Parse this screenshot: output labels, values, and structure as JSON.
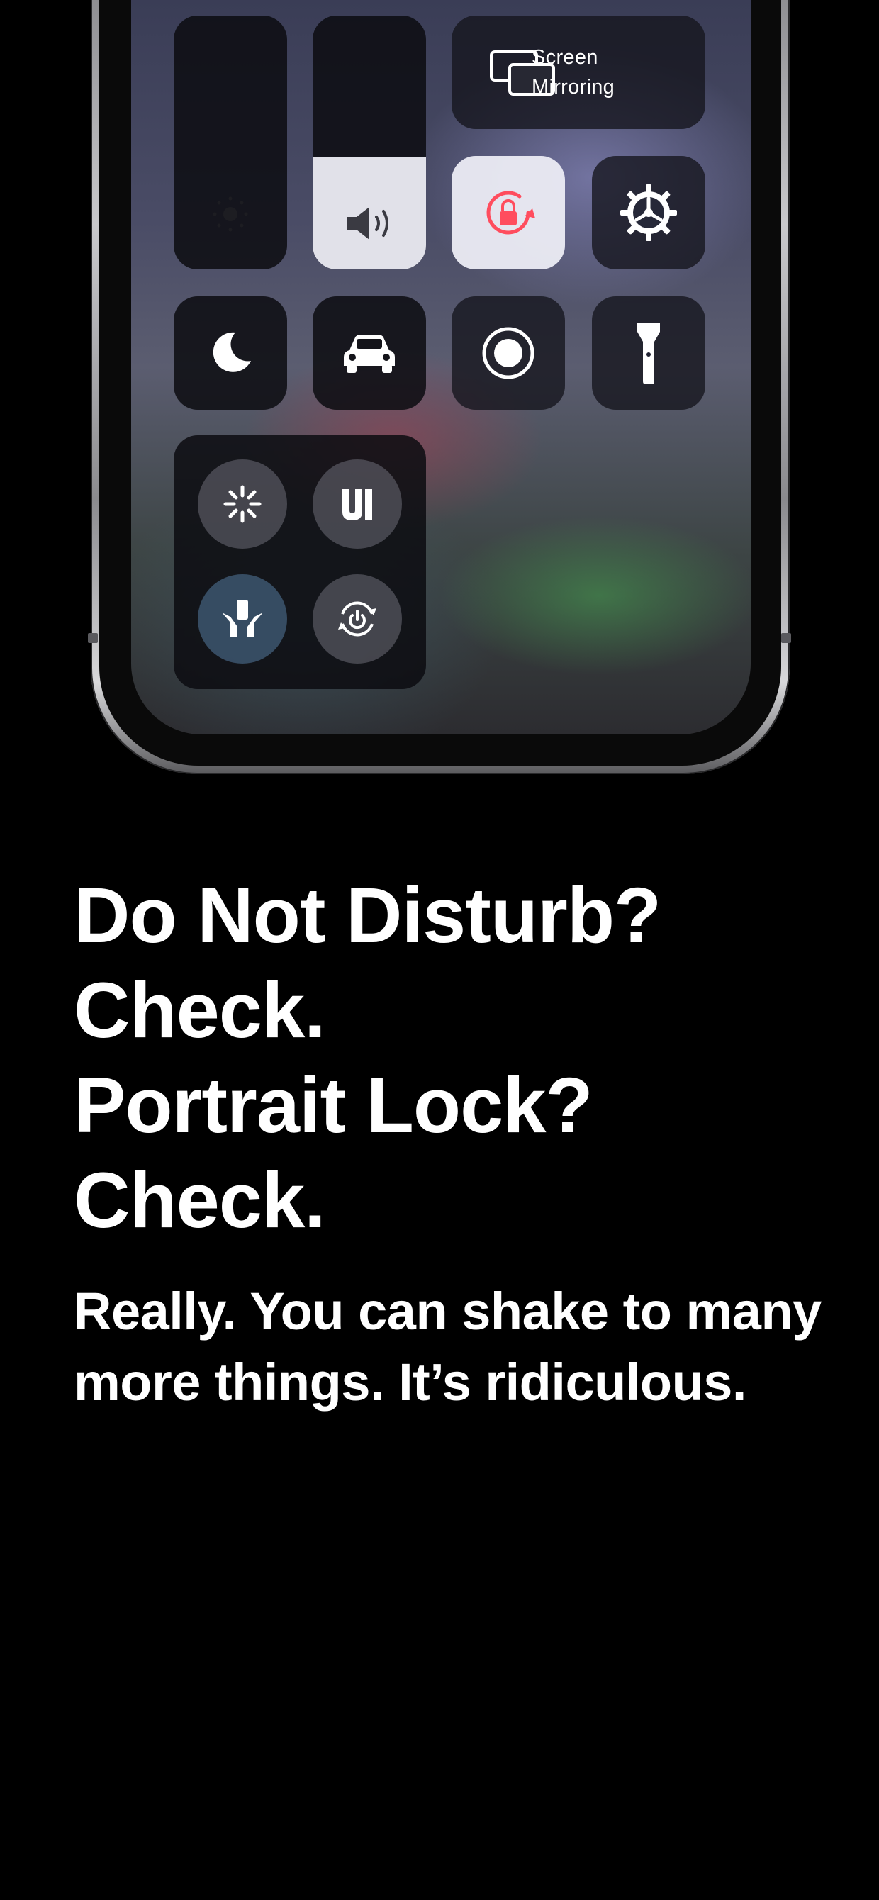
{
  "control_center": {
    "screen_mirroring": {
      "label_line1": "Screen",
      "label_line2": "Mirroring",
      "icon": "screen-mirroring-icon"
    },
    "brightness": {
      "level": 0.0,
      "icon": "brightness-icon"
    },
    "volume": {
      "level": 0.44,
      "icon": "speaker-icon"
    },
    "portrait_lock": {
      "active": true,
      "icon": "rotation-lock-icon",
      "accent": "#ff4d5e"
    },
    "settings": {
      "icon": "gear-icon"
    },
    "do_not_disturb": {
      "icon": "moon-icon"
    },
    "driving": {
      "icon": "car-icon"
    },
    "screen_record": {
      "icon": "record-icon"
    },
    "flashlight": {
      "icon": "flashlight-icon"
    },
    "module_buttons": [
      {
        "icon": "activity-icon"
      },
      {
        "icon": "ui-icon"
      },
      {
        "icon": "hands-phone-icon"
      },
      {
        "icon": "power-rotate-icon"
      }
    ]
  },
  "headline": {
    "line1": "Do Not Disturb?",
    "line2": "Check.",
    "line3": "Portrait Lock?",
    "line4": "Check."
  },
  "subline": {
    "line1": "Really. You can shake to many",
    "line2": "more things. It’s ridiculous."
  },
  "colors": {
    "background": "#000000",
    "text": "#ffffff",
    "lock_accent": "#ff4d5e"
  }
}
